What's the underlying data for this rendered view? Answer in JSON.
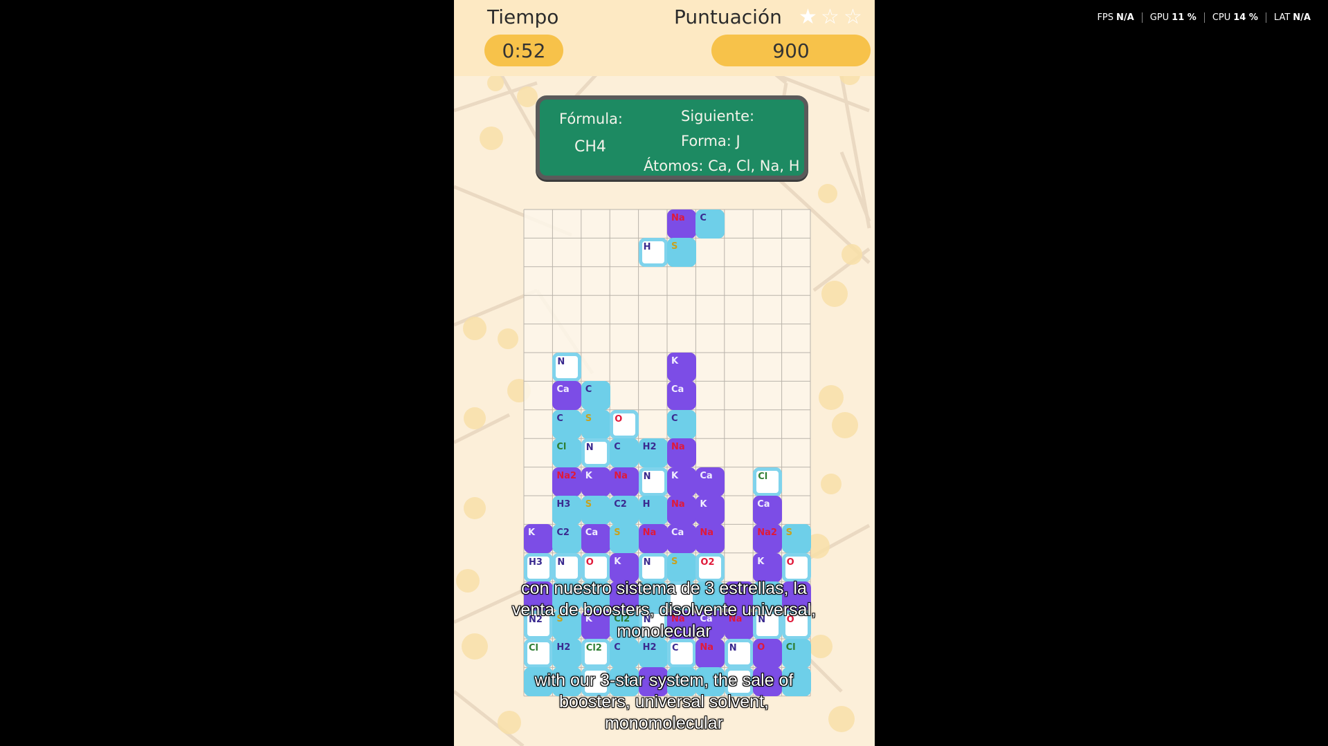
{
  "header": {
    "time_label": "Tiempo",
    "time_value": "0:52",
    "score_label": "Puntuación",
    "score_value": "900",
    "stars_filled": 1,
    "stars_total": 3
  },
  "formula_board": {
    "formula_label": "Fórmula:",
    "formula_value": "CH4",
    "next_label": "Siguiente:",
    "shape_text": "Forma: J",
    "atoms_text": "Átomos: Ca, Cl, Na, H"
  },
  "falling_piece": [
    {
      "label": "Na",
      "style": "purple",
      "col": 5,
      "row": 0
    },
    {
      "label": "C",
      "style": "blue",
      "col": 6,
      "row": 0
    },
    {
      "label": "H",
      "style": "white",
      "col": 4,
      "row": 1
    },
    {
      "label": "S",
      "style": "blue",
      "col": 5,
      "row": 1
    }
  ],
  "stack": [
    {
      "label": "N",
      "style": "white",
      "col": 1,
      "row": 5
    },
    {
      "label": "K",
      "style": "purple",
      "col": 5,
      "row": 5
    },
    {
      "label": "Ca",
      "style": "purple",
      "col": 1,
      "row": 6
    },
    {
      "label": "C",
      "style": "blue",
      "col": 2,
      "row": 6
    },
    {
      "label": "Ca",
      "style": "purple",
      "col": 5,
      "row": 6
    },
    {
      "label": "C",
      "style": "blue",
      "col": 1,
      "row": 7
    },
    {
      "label": "S",
      "style": "blue",
      "col": 2,
      "row": 7
    },
    {
      "label": "O",
      "style": "white",
      "col": 3,
      "row": 7
    },
    {
      "label": "C",
      "style": "blue",
      "col": 5,
      "row": 7
    },
    {
      "label": "Cl",
      "style": "blue",
      "col": 1,
      "row": 8
    },
    {
      "label": "N",
      "style": "white",
      "col": 2,
      "row": 8
    },
    {
      "label": "C",
      "style": "blue",
      "col": 3,
      "row": 8
    },
    {
      "label": "H2",
      "style": "blue",
      "col": 4,
      "row": 8
    },
    {
      "label": "Na",
      "style": "purple",
      "col": 5,
      "row": 8
    },
    {
      "label": "Na2",
      "style": "purple",
      "col": 1,
      "row": 9
    },
    {
      "label": "K",
      "style": "purple",
      "col": 2,
      "row": 9
    },
    {
      "label": "Na",
      "style": "purple",
      "col": 3,
      "row": 9
    },
    {
      "label": "N",
      "style": "white",
      "col": 4,
      "row": 9
    },
    {
      "label": "K",
      "style": "purple",
      "col": 5,
      "row": 9
    },
    {
      "label": "Ca",
      "style": "purple",
      "col": 6,
      "row": 9
    },
    {
      "label": "Cl",
      "style": "white",
      "col": 8,
      "row": 9
    },
    {
      "label": "H3",
      "style": "blue",
      "col": 1,
      "row": 10
    },
    {
      "label": "S",
      "style": "blue",
      "col": 2,
      "row": 10
    },
    {
      "label": "C2",
      "style": "blue",
      "col": 3,
      "row": 10
    },
    {
      "label": "H",
      "style": "blue",
      "col": 4,
      "row": 10
    },
    {
      "label": "Na",
      "style": "purple",
      "col": 5,
      "row": 10
    },
    {
      "label": "K",
      "style": "purple",
      "col": 6,
      "row": 10
    },
    {
      "label": "Ca",
      "style": "purple",
      "col": 8,
      "row": 10
    },
    {
      "label": "K",
      "style": "purple",
      "col": 0,
      "row": 11
    },
    {
      "label": "C2",
      "style": "blue",
      "col": 1,
      "row": 11
    },
    {
      "label": "Ca",
      "style": "purple",
      "col": 2,
      "row": 11
    },
    {
      "label": "S",
      "style": "blue",
      "col": 3,
      "row": 11
    },
    {
      "label": "Na",
      "style": "purple",
      "col": 4,
      "row": 11
    },
    {
      "label": "Ca",
      "style": "purple",
      "col": 5,
      "row": 11
    },
    {
      "label": "Na",
      "style": "purple",
      "col": 6,
      "row": 11
    },
    {
      "label": "Na2",
      "style": "purple",
      "col": 8,
      "row": 11
    },
    {
      "label": "S",
      "style": "blue",
      "col": 9,
      "row": 11
    },
    {
      "label": "H3",
      "style": "white",
      "col": 0,
      "row": 12
    },
    {
      "label": "N",
      "style": "white",
      "col": 1,
      "row": 12
    },
    {
      "label": "O",
      "style": "white",
      "col": 2,
      "row": 12
    },
    {
      "label": "K",
      "style": "purple",
      "col": 3,
      "row": 12
    },
    {
      "label": "N",
      "style": "white",
      "col": 4,
      "row": 12
    },
    {
      "label": "S",
      "style": "blue",
      "col": 5,
      "row": 12
    },
    {
      "label": "O2",
      "style": "white",
      "col": 6,
      "row": 12
    },
    {
      "label": "K",
      "style": "purple",
      "col": 8,
      "row": 12
    },
    {
      "label": "O",
      "style": "white",
      "col": 9,
      "row": 12
    },
    {
      "label": "",
      "style": "purple",
      "col": 0,
      "row": 13
    },
    {
      "label": "",
      "style": "blue",
      "col": 1,
      "row": 13
    },
    {
      "label": "",
      "style": "blue",
      "col": 2,
      "row": 13
    },
    {
      "label": "",
      "style": "purple",
      "col": 3,
      "row": 13
    },
    {
      "label": "",
      "style": "blue",
      "col": 4,
      "row": 13
    },
    {
      "label": "",
      "style": "white",
      "col": 5,
      "row": 13
    },
    {
      "label": "",
      "style": "blue",
      "col": 6,
      "row": 13
    },
    {
      "label": "",
      "style": "purple",
      "col": 7,
      "row": 13
    },
    {
      "label": "",
      "style": "blue",
      "col": 8,
      "row": 13
    },
    {
      "label": "",
      "style": "purple",
      "col": 9,
      "row": 13
    },
    {
      "label": "N2",
      "style": "white",
      "col": 0,
      "row": 14
    },
    {
      "label": "S",
      "style": "blue",
      "col": 1,
      "row": 14
    },
    {
      "label": "K",
      "style": "purple",
      "col": 2,
      "row": 14
    },
    {
      "label": "Cl2",
      "style": "blue",
      "col": 3,
      "row": 14
    },
    {
      "label": "N",
      "style": "white",
      "col": 4,
      "row": 14
    },
    {
      "label": "Na",
      "style": "purple",
      "col": 5,
      "row": 14
    },
    {
      "label": "Ca",
      "style": "purple",
      "col": 6,
      "row": 14
    },
    {
      "label": "Na",
      "style": "purple",
      "col": 7,
      "row": 14
    },
    {
      "label": "N",
      "style": "white",
      "col": 8,
      "row": 14
    },
    {
      "label": "O",
      "style": "white",
      "col": 9,
      "row": 14
    },
    {
      "label": "Cl",
      "style": "white",
      "col": 0,
      "row": 15
    },
    {
      "label": "H2",
      "style": "blue",
      "col": 1,
      "row": 15
    },
    {
      "label": "Cl2",
      "style": "white",
      "col": 2,
      "row": 15
    },
    {
      "label": "C",
      "style": "blue",
      "col": 3,
      "row": 15
    },
    {
      "label": "H2",
      "style": "blue",
      "col": 4,
      "row": 15
    },
    {
      "label": "C",
      "style": "white",
      "col": 5,
      "row": 15
    },
    {
      "label": "Na",
      "style": "purple",
      "col": 6,
      "row": 15
    },
    {
      "label": "N",
      "style": "white",
      "col": 7,
      "row": 15
    },
    {
      "label": "O",
      "style": "purple",
      "col": 8,
      "row": 15
    },
    {
      "label": "Cl",
      "style": "blue",
      "col": 9,
      "row": 15
    },
    {
      "label": "",
      "style": "blue",
      "col": 0,
      "row": 16
    },
    {
      "label": "",
      "style": "blue",
      "col": 1,
      "row": 16
    },
    {
      "label": "",
      "style": "white",
      "col": 2,
      "row": 16
    },
    {
      "label": "",
      "style": "blue",
      "col": 3,
      "row": 16
    },
    {
      "label": "",
      "style": "purple",
      "col": 4,
      "row": 16
    },
    {
      "label": "",
      "style": "blue",
      "col": 5,
      "row": 16
    },
    {
      "label": "",
      "style": "blue",
      "col": 6,
      "row": 16
    },
    {
      "label": "",
      "style": "white",
      "col": 7,
      "row": 16
    },
    {
      "label": "",
      "style": "purple",
      "col": 8,
      "row": 16
    },
    {
      "label": "",
      "style": "blue",
      "col": 9,
      "row": 16
    }
  ],
  "subtitles": {
    "spanish_line1": "con nuestro sistema de 3 estrellas, la",
    "spanish_line2": "venta de boosters, disolvente universal,",
    "spanish_line3": "monolecular",
    "english_line1": "with our 3-star system, the sale of",
    "english_line2": "boosters, universal solvent,",
    "english_line3": "monomolecular"
  },
  "perf_overlay": {
    "fps_label": "FPS",
    "fps_value": "N/A",
    "gpu_label": "GPU",
    "gpu_value": "11 %",
    "cpu_label": "CPU",
    "cpu_value": "14 %",
    "lat_label": "LAT",
    "lat_value": "N/A"
  },
  "colors": {
    "tile_purple": "#7c4de6",
    "tile_blue": "#6ecfe9",
    "tile_white_border": "#7fd3ec",
    "header_pill": "#f7c24a",
    "board_green": "#1d8a62",
    "star_filled": "#ffffff",
    "label_red": "#e0193a",
    "label_purple_text": "#3a2a8f",
    "label_green": "#2e7d32",
    "label_yellow": "#c8a21e"
  }
}
